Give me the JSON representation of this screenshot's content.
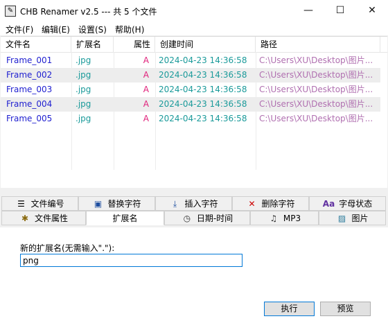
{
  "window": {
    "title": "CHB Renamer v2.5 --- 共 5 个文件",
    "minimize": "—",
    "maximize": "☐",
    "close": "✕"
  },
  "menu": [
    "文件(F)",
    "编辑(E)",
    "设置(S)",
    "帮助(H)"
  ],
  "table": {
    "headers": [
      "文件名",
      "扩展名",
      "属性",
      "创建时间",
      "路径"
    ],
    "rows": [
      {
        "name": "Frame_001",
        "ext": ".jpg",
        "attr": "A",
        "time": "2024-04-23 14:36:58",
        "path": "C:\\Users\\XU\\Desktop\\图片..."
      },
      {
        "name": "Frame_002",
        "ext": ".jpg",
        "attr": "A",
        "time": "2024-04-23 14:36:58",
        "path": "C:\\Users\\XU\\Desktop\\图片..."
      },
      {
        "name": "Frame_003",
        "ext": ".jpg",
        "attr": "A",
        "time": "2024-04-23 14:36:58",
        "path": "C:\\Users\\XU\\Desktop\\图片..."
      },
      {
        "name": "Frame_004",
        "ext": ".jpg",
        "attr": "A",
        "time": "2024-04-23 14:36:58",
        "path": "C:\\Users\\XU\\Desktop\\图片..."
      },
      {
        "name": "Frame_005",
        "ext": ".jpg",
        "attr": "A",
        "time": "2024-04-23 14:36:58",
        "path": "C:\\Users\\XU\\Desktop\\图片..."
      }
    ]
  },
  "tabs_row1": [
    {
      "label": "文件编号",
      "icon": "list-icon",
      "glyph": "☰"
    },
    {
      "label": "替换字符",
      "icon": "replace-icon",
      "glyph": "▣"
    },
    {
      "label": "插入字符",
      "icon": "insert-arrow-icon",
      "glyph": "⤓"
    },
    {
      "label": "删除字符",
      "icon": "delete-x-icon",
      "glyph": "✕"
    },
    {
      "label": "字母状态",
      "icon": "letter-case-icon",
      "glyph": "Aa"
    }
  ],
  "tabs_row2": [
    {
      "label": "文件属性",
      "icon": "gear-icon",
      "glyph": "✱"
    },
    {
      "label": "扩展名",
      "icon": "",
      "glyph": ""
    },
    {
      "label": "日期-时间",
      "icon": "clock-icon",
      "glyph": "◷"
    },
    {
      "label": "MP3",
      "icon": "music-file-icon",
      "glyph": "♫"
    },
    {
      "label": "图片",
      "icon": "image-icon",
      "glyph": "▨"
    }
  ],
  "panel": {
    "label": "新的扩展名(无需输入\".\"):",
    "value": "png"
  },
  "buttons": {
    "execute": "执行",
    "preview": "预览"
  },
  "colors": {
    "name": "#1f1fd0",
    "ext": "#1a9a9a",
    "attr": "#e0207a",
    "path": "#b06fb0",
    "accent": "#0078d7"
  }
}
